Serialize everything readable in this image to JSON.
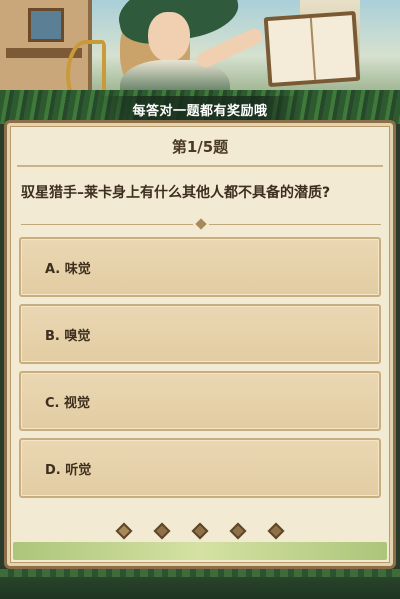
{
  "banner": {
    "subtitle": "每答对一题都有奖励哦"
  },
  "quiz": {
    "progress": "第1/5题",
    "question": "驭星猎手–莱卡身上有什么其他人都不具备的潜质?",
    "options": [
      {
        "label": "A. 味觉"
      },
      {
        "label": "B. 嗅觉"
      },
      {
        "label": "C. 视觉"
      },
      {
        "label": "D. 听觉"
      }
    ],
    "current_question": 1,
    "total_questions": 5
  },
  "colors": {
    "panel_bg": "#f3ead4",
    "option_bg": "#e2cca3",
    "panel_border": "#8c6f48",
    "text": "#3d2e1e"
  }
}
